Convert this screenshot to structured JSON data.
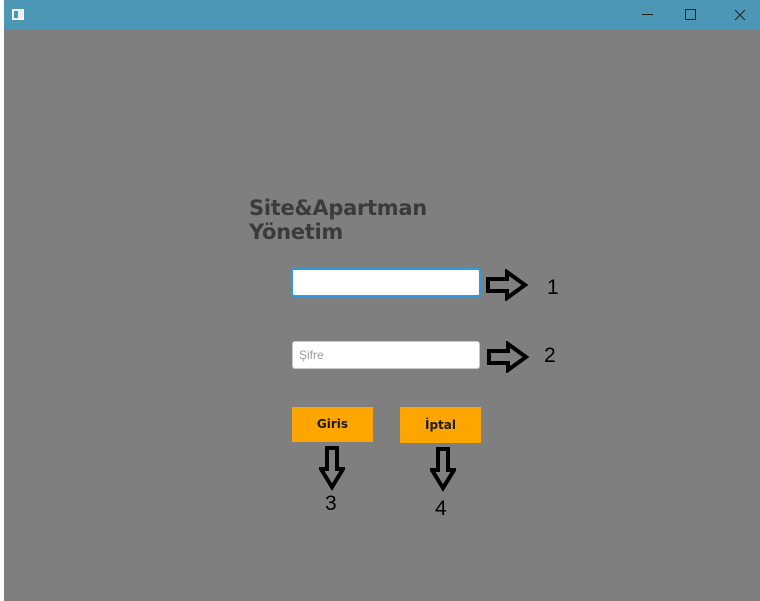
{
  "window": {
    "title": "",
    "controls": {
      "minimize": "—",
      "maximize": "☐",
      "close": "✕"
    }
  },
  "login": {
    "heading": "Site&Apartman Yönetim",
    "username": {
      "value": "",
      "placeholder": ""
    },
    "password": {
      "value": "",
      "placeholder": "Şifre"
    },
    "login_button": "Giris",
    "cancel_button": "İptal"
  },
  "annotations": {
    "labels": [
      "1",
      "2",
      "3",
      "4"
    ]
  },
  "colors": {
    "titlebar": "#4c97b5",
    "background": "#7f7f7f",
    "button": "#ffa500",
    "focus_border": "#2e9be0"
  }
}
